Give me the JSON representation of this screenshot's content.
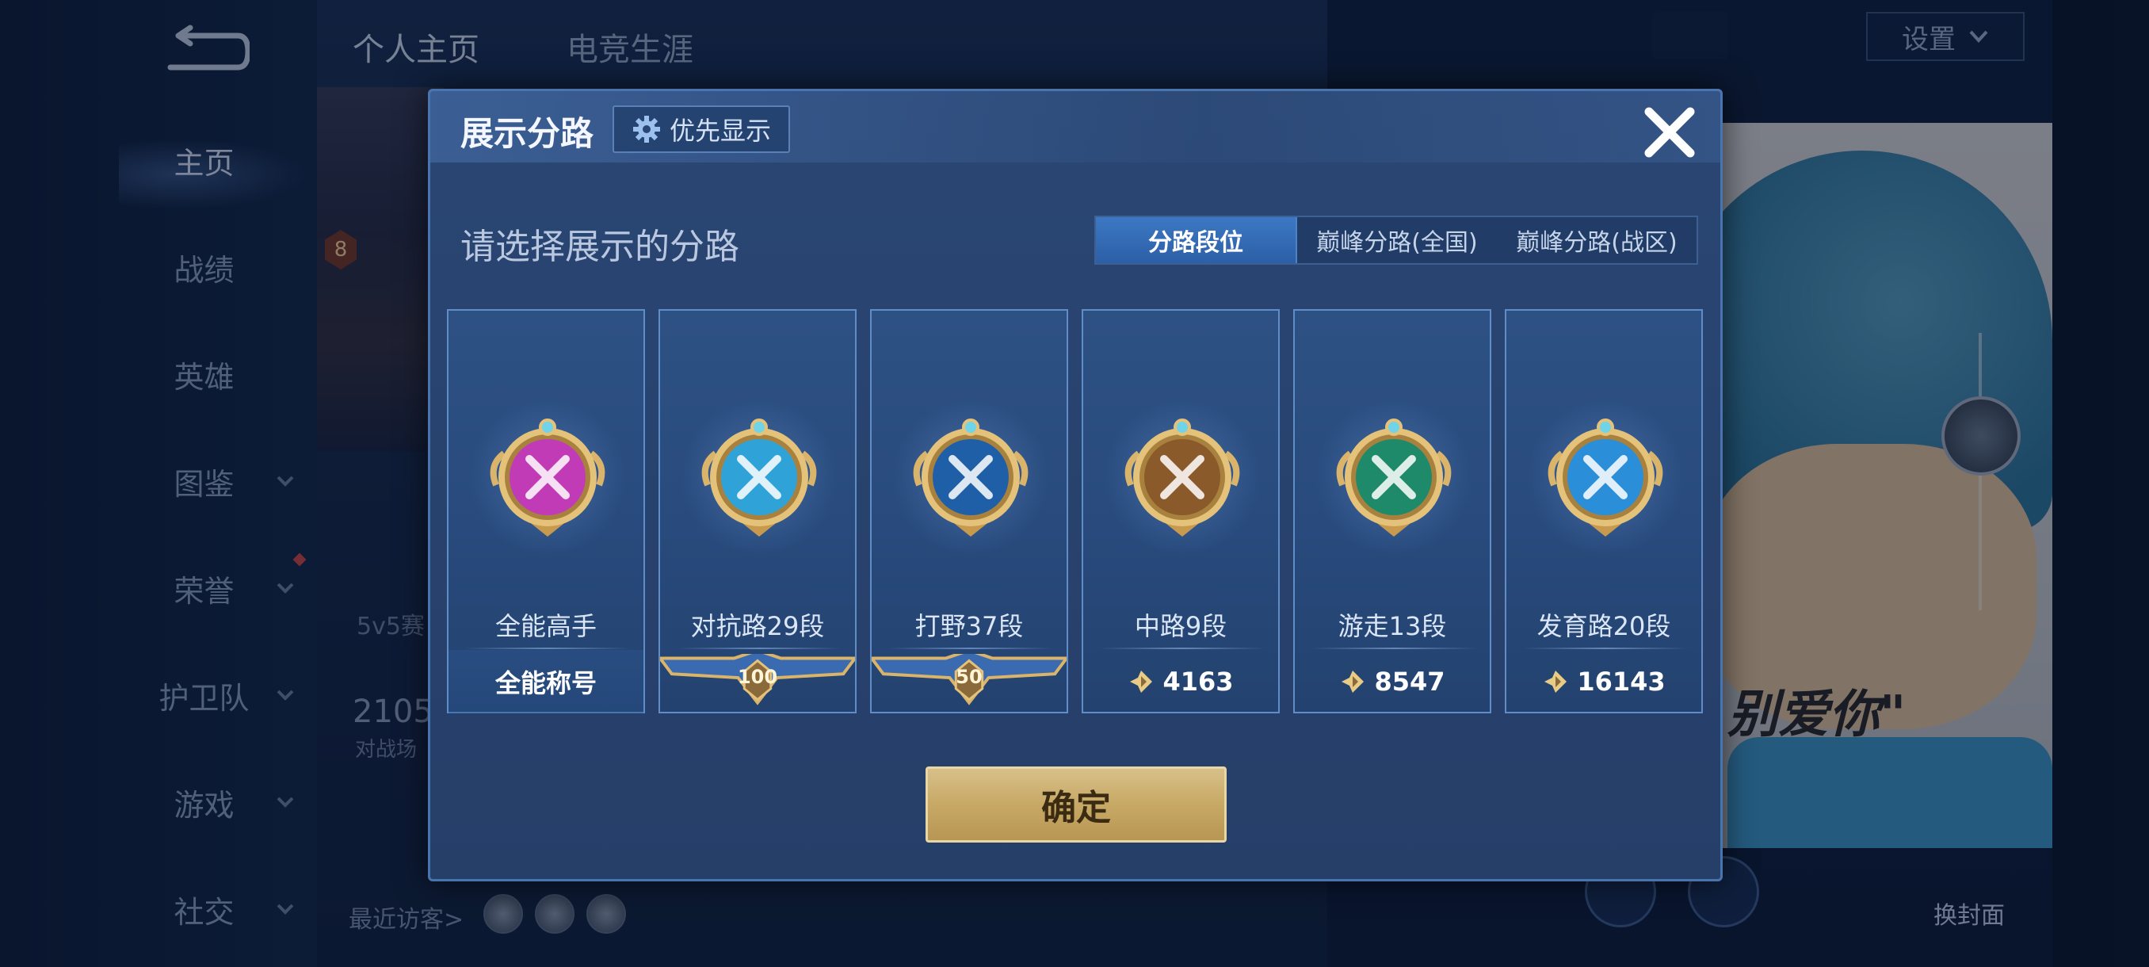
{
  "background": {
    "nav": {
      "items": [
        {
          "label": "主页",
          "has_chevron": false,
          "active": true
        },
        {
          "label": "战绩",
          "has_chevron": false
        },
        {
          "label": "英雄",
          "has_chevron": false
        },
        {
          "label": "图鉴",
          "has_chevron": true
        },
        {
          "label": "荣誉",
          "has_chevron": true
        },
        {
          "label": "护卫队",
          "has_chevron": true
        },
        {
          "label": "游戏",
          "has_chevron": true
        },
        {
          "label": "社交",
          "has_chevron": true
        }
      ]
    },
    "tabs": [
      "个人主页",
      "电竞生涯"
    ],
    "level": "8",
    "stat_label": "5v5赛",
    "stat_value": "2105",
    "stat_caption": "对战场",
    "recent_visitors": "最近访客>",
    "settings_label": "设置",
    "cover_text": "别爱你\"",
    "change_cover_label": "换封面"
  },
  "modal": {
    "title": "展示分路",
    "priority_label": "优先显示",
    "subtitle": "请选择展示的分路",
    "segments": [
      "分路段位",
      "巅峰分路(全国)",
      "巅峰分路(战区)"
    ],
    "active_segment": 0,
    "cards": [
      {
        "role": "全能高手",
        "footer_type": "text",
        "footer": "全能称号",
        "medal_color": "#c23bb6"
      },
      {
        "role": "对抗路29段",
        "footer_type": "stars",
        "footer": "100",
        "medal_color": "#2fa3d8"
      },
      {
        "role": "打野37段",
        "footer_type": "stars",
        "footer": "50",
        "medal_color": "#1f5fa8"
      },
      {
        "role": "中路9段",
        "footer_type": "points",
        "footer": "4163",
        "medal_color": "#8a5a2a"
      },
      {
        "role": "游走13段",
        "footer_type": "points",
        "footer": "8547",
        "medal_color": "#1e8a6a"
      },
      {
        "role": "发育路20段",
        "footer_type": "points",
        "footer": "16143",
        "medal_color": "#2a8fd8"
      }
    ],
    "confirm_label": "确定"
  },
  "colors": {
    "accent_gold": "#c7a965",
    "active_tab": "#3d78c4",
    "card_border": "#5f8dc8"
  }
}
